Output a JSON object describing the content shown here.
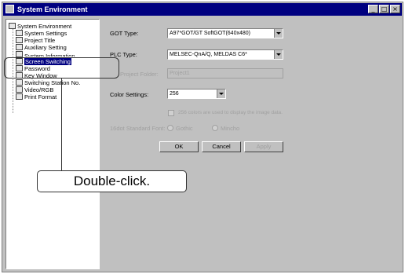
{
  "window": {
    "title": "System Environment",
    "controls": [
      "_",
      "□",
      "×"
    ]
  },
  "tree": {
    "items": [
      {
        "label": "System Environment",
        "icon": "system-icon"
      },
      {
        "label": "System Settings",
        "icon": "settings-icon"
      },
      {
        "label": "Project Title",
        "icon": "title-icon"
      },
      {
        "label": "Auxiliary Setting",
        "icon": "auxiliary-icon"
      },
      {
        "label": "System Information",
        "icon": "info-icon"
      },
      {
        "label": "Screen Switching",
        "icon": "screen-icon",
        "selected": true
      },
      {
        "label": "Password",
        "icon": "password-icon"
      },
      {
        "label": "Key Window",
        "icon": "key-icon"
      },
      {
        "label": "Switching Station No.",
        "icon": "station-icon"
      },
      {
        "label": "Video/RGB",
        "icon": "video-icon"
      },
      {
        "label": "Print Format",
        "icon": "print-icon"
      }
    ]
  },
  "form": {
    "got_type_label": "GOT Type:",
    "got_type_value": "A97*GOT/GT SoftGOT(640x480)",
    "plc_type_label": "PLC Type:",
    "plc_type_value": "MELSEC-QnA/Q, MELDAS C6*",
    "project_folder_label": "Project Folder:",
    "project_folder_value": "Project1",
    "color_settings_label": "Color Settings:",
    "color_settings_value": "256",
    "checkbox_label": "256 colors are used to display the image data.",
    "font_label": "16dot Standard Font:",
    "font_option_1": "Gothic",
    "font_option_2": "Mincho"
  },
  "buttons": {
    "ok": "OK",
    "cancel": "Cancel",
    "apply": "Apply"
  },
  "callout": {
    "text": "Double-click."
  }
}
